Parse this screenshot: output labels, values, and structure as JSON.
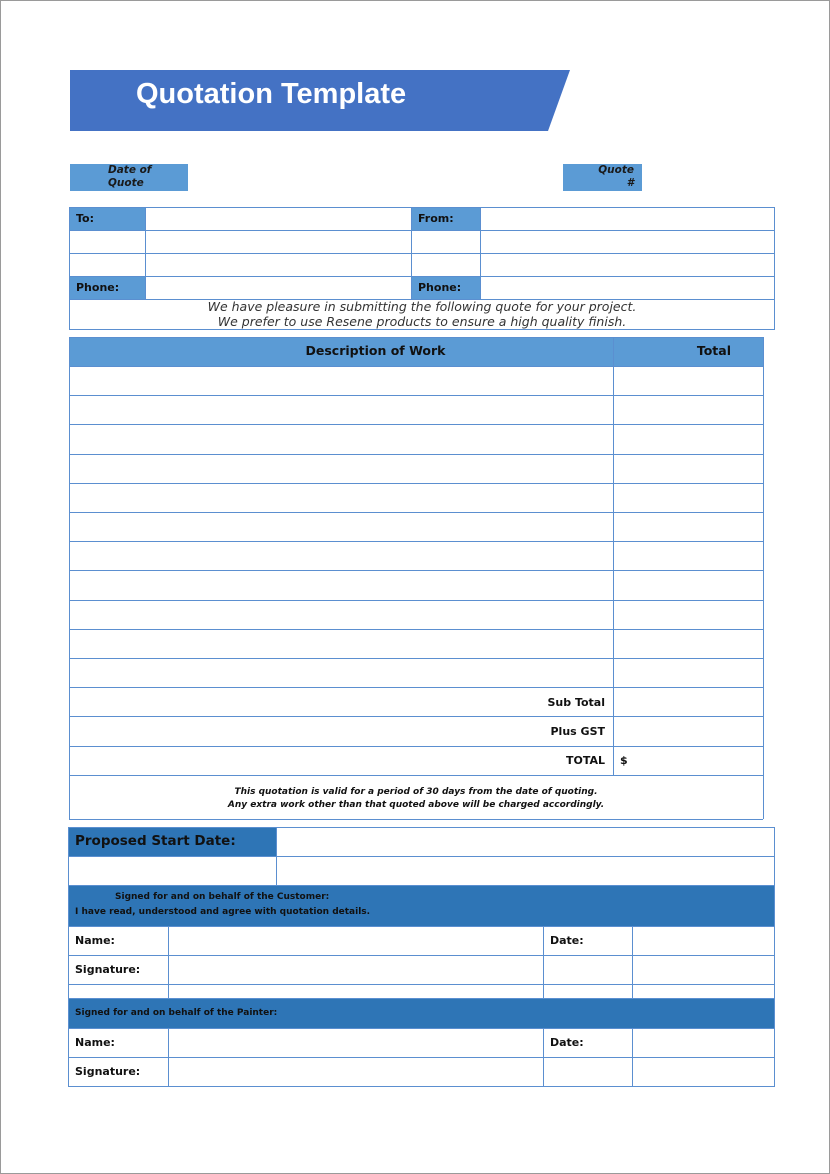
{
  "header": {
    "title": "Quotation Template",
    "banner_color": "#4472c4"
  },
  "quote_meta": {
    "date_label_line1": "Date of",
    "date_label_line2": "Quote",
    "date_value": "",
    "quote_label_line1": "Quote",
    "quote_label_line2": "#",
    "quote_value": ""
  },
  "contact": {
    "to_label": "To:",
    "from_label": "From:",
    "phone_label_left": "Phone:",
    "phone_label_right": "Phone:",
    "to_lines": [
      "",
      "",
      ""
    ],
    "from_lines": [
      "",
      "",
      ""
    ],
    "phone_left": "",
    "phone_right": "",
    "intro_line1": "We have pleasure in submitting the following quote for your project.",
    "intro_line2": "We prefer to use Resene products to ensure a high quality finish."
  },
  "work_table": {
    "columns": [
      "Description of Work",
      "Total"
    ],
    "rows": [
      {
        "description": "",
        "total": ""
      },
      {
        "description": "",
        "total": ""
      },
      {
        "description": "",
        "total": ""
      },
      {
        "description": "",
        "total": ""
      },
      {
        "description": "",
        "total": ""
      },
      {
        "description": "",
        "total": ""
      },
      {
        "description": "",
        "total": ""
      },
      {
        "description": "",
        "total": ""
      },
      {
        "description": "",
        "total": ""
      },
      {
        "description": "",
        "total": ""
      },
      {
        "description": "",
        "total": ""
      }
    ],
    "subtotal_label": "Sub Total",
    "gst_label": "Plus GST",
    "total_label": "TOTAL",
    "currency_symbol": "$",
    "subtotal_value": "",
    "gst_value": "",
    "total_value": "",
    "validity_line1": "This quotation is valid for a period of 30 days from the date of quoting.",
    "validity_line2": "Any extra work other than that quoted above will be charged accordingly."
  },
  "start": {
    "label": "Proposed Start Date:",
    "value": ""
  },
  "customer_sign": {
    "heading_line1": "Signed for and on behalf of the Customer:",
    "heading_line2": "I have read, understood and agree with quotation details.",
    "name_label": "Name:",
    "date_label": "Date:",
    "signature_label": "Signature:"
  },
  "painter_sign": {
    "heading": "Signed for and on behalf of the Painter:",
    "name_label": "Name:",
    "date_label": "Date:",
    "signature_label": "Signature:"
  },
  "colors": {
    "label_blue": "#5b9bd5",
    "band_blue": "#2e75b6",
    "grid_blue": "#5b8fd0"
  }
}
